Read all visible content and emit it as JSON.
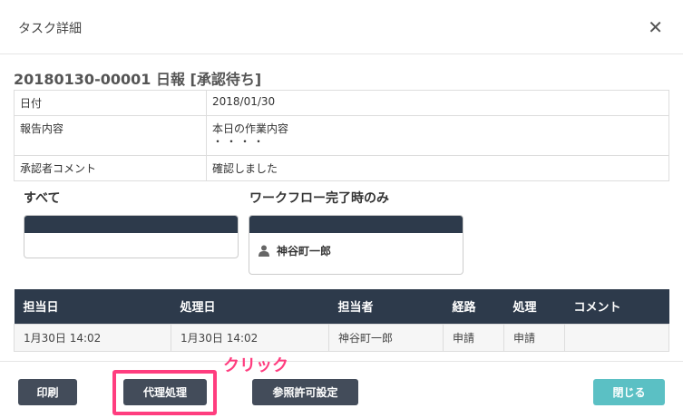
{
  "header": {
    "title": "タスク詳細"
  },
  "task": {
    "heading": "20180130-00001 日報 [承認待ち]"
  },
  "info": [
    {
      "key": "日付",
      "value": "2018/01/30",
      "extra": ""
    },
    {
      "key": "報告内容",
      "value": "本日の作業内容",
      "extra": "・・・・"
    },
    {
      "key": "承認者コメント",
      "value": "確認しました",
      "extra": ""
    }
  ],
  "groups": {
    "all": {
      "title": "すべて"
    },
    "workflow": {
      "title": "ワークフロー完了時のみ",
      "member": "神谷町一郎"
    }
  },
  "history": {
    "columns": [
      "担当日",
      "処理日",
      "担当者",
      "経路",
      "処理",
      "コメント"
    ],
    "rows": [
      [
        "1月30日 14:02",
        "1月30日 14:02",
        "神谷町一郎",
        "申請",
        "申請",
        ""
      ]
    ]
  },
  "footer": {
    "print_label": "印刷",
    "proxy_label": "代理処理",
    "permission_label": "参照許可設定",
    "close_label": "閉じる"
  },
  "annotation": {
    "label": "クリック",
    "color": "#ff3d7f"
  }
}
